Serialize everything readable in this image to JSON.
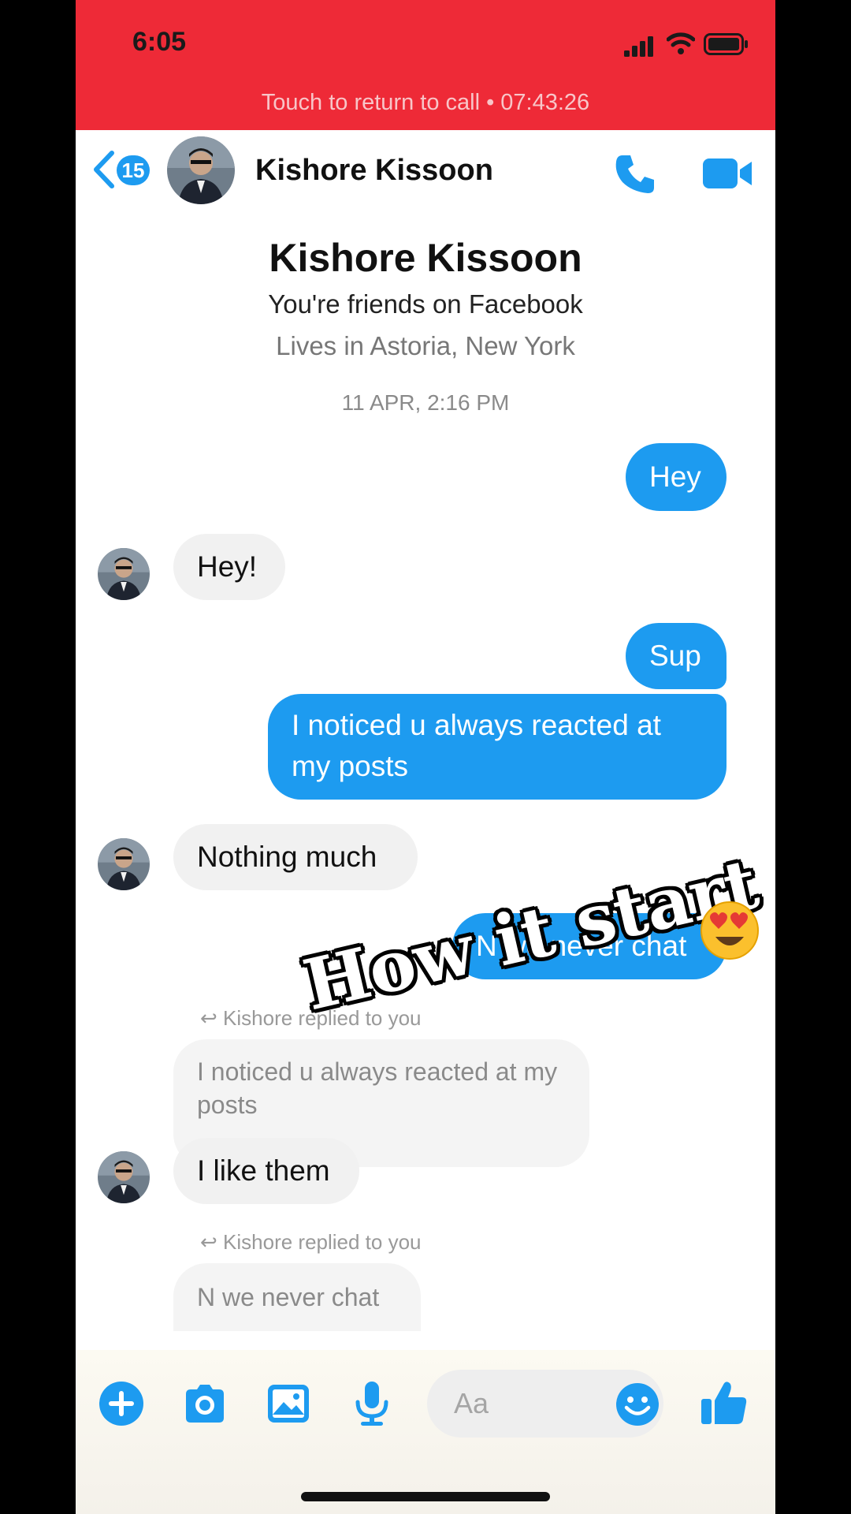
{
  "status_bar": {
    "time": "6:05",
    "call_banner": "Touch to return to call • 07:43:26"
  },
  "header": {
    "back_badge": "15",
    "contact_name": "Kishore Kissoon"
  },
  "profile": {
    "name": "Kishore Kissoon",
    "friends_text": "You're friends on Facebook",
    "location_text": "Lives in Astoria, New York",
    "timestamp": "11 APR, 2:16 PM"
  },
  "messages": [
    {
      "from": "me",
      "text": "Hey"
    },
    {
      "from": "them",
      "text": "Hey!"
    },
    {
      "from": "me",
      "text": "Sup"
    },
    {
      "from": "me",
      "text": "I noticed u always reacted at my posts"
    },
    {
      "from": "them",
      "text": "Nothing much"
    },
    {
      "from": "me",
      "text": "N we never chat"
    },
    {
      "from": "them",
      "replied_label": "Kishore replied to you",
      "quoted_text": "I noticed u always reacted at my posts",
      "text": "I like them"
    },
    {
      "from": "them",
      "replied_label": "Kishore replied to you",
      "quoted_text": "N we never chat"
    }
  ],
  "overlay": {
    "caption": "How it start",
    "emoji": "heart-eyes-emoji"
  },
  "composer": {
    "placeholder": "Aa"
  },
  "colors": {
    "status_bar": "#ee2a37",
    "accent": "#1d9bf0",
    "incoming_bubble": "#f1f1f1"
  },
  "icons": [
    "back-chevron-icon",
    "phone-icon",
    "video-camera-icon",
    "plus-icon",
    "camera-icon",
    "photo-icon",
    "microphone-icon",
    "smiley-icon",
    "thumbs-up-icon"
  ]
}
